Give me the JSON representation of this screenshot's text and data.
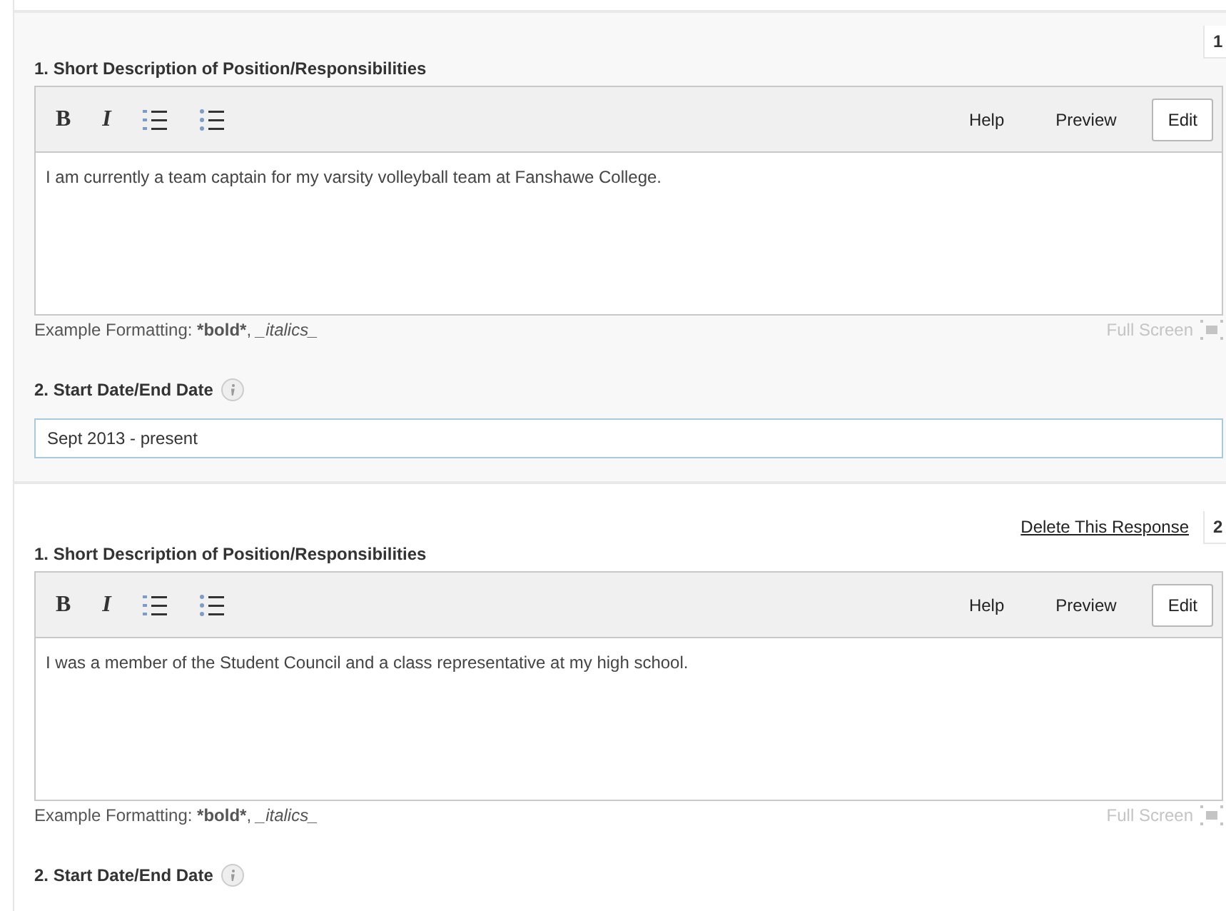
{
  "responses": [
    {
      "number": "1",
      "question": "1. Short Description of Position/Responsibilities",
      "format_tools": [
        {
          "kind": "bold",
          "label": "B"
        },
        {
          "kind": "italic",
          "label": "I"
        },
        {
          "kind": "numbered-list"
        },
        {
          "kind": "bulleted-list"
        }
      ],
      "modes": [
        {
          "label": "Help",
          "selected": false
        },
        {
          "label": "Preview",
          "selected": false
        },
        {
          "label": "Edit",
          "selected": true
        }
      ],
      "text": "I am currently a team captain for my varsity volleyball team at Fanshawe College.",
      "hint": {
        "prefix": "Example Formatting: ",
        "bold": "*bold*",
        "separator": ", ",
        "italic": "_italics_"
      },
      "full_screen": "Full Screen",
      "date_label": "2. Start Date/End Date",
      "date_value": "Sept 2013 - present"
    },
    {
      "number": "2",
      "delete_link": "Delete This Response",
      "question": "1. Short Description of Position/Responsibilities",
      "format_tools": [
        {
          "kind": "bold",
          "label": "B"
        },
        {
          "kind": "italic",
          "label": "I"
        },
        {
          "kind": "numbered-list"
        },
        {
          "kind": "bulleted-list"
        }
      ],
      "modes": [
        {
          "label": "Help",
          "selected": false
        },
        {
          "label": "Preview",
          "selected": false
        },
        {
          "label": "Edit",
          "selected": true
        }
      ],
      "text": "I was a member of the Student Council and a class representative at my high school.",
      "hint": {
        "prefix": "Example Formatting: ",
        "bold": "*bold*",
        "separator": ", ",
        "italic": "_italics_"
      },
      "full_screen": "Full Screen",
      "date_label": "2. Start Date/End Date"
    }
  ]
}
